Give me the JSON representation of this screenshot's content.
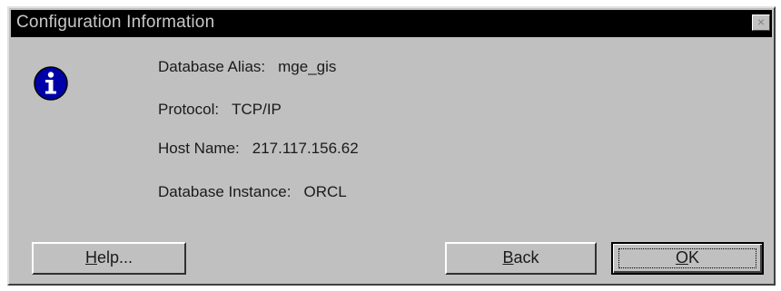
{
  "window": {
    "title": "Configuration Information",
    "close_glyph": "×"
  },
  "icon": {
    "name": "info-icon",
    "glyph": "i",
    "color": "#0000a8"
  },
  "fields": [
    {
      "label": "Database Alias:",
      "value": "mge_gis"
    },
    {
      "label": "Protocol:",
      "value": "TCP/IP"
    },
    {
      "label": "Host Name:",
      "value": "217.117.156.62"
    },
    {
      "label": "Database Instance:",
      "value": "ORCL"
    }
  ],
  "buttons": {
    "help": {
      "mnemonic": "H",
      "rest": "elp..."
    },
    "back": {
      "mnemonic": "B",
      "rest": "ack"
    },
    "ok": {
      "mnemonic": "O",
      "rest": "K"
    }
  }
}
